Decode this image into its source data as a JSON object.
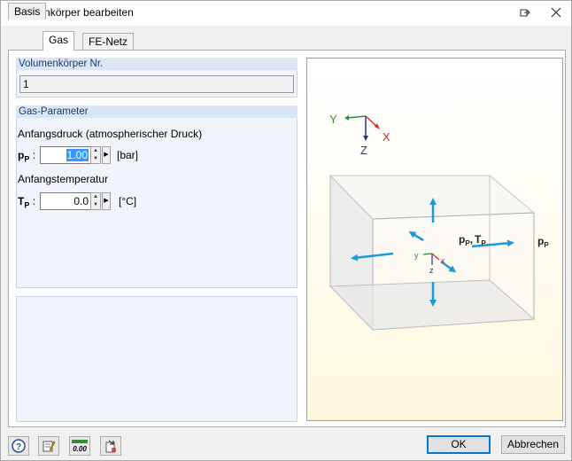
{
  "window": {
    "title": "Volumenkörper bearbeiten"
  },
  "titlebar": {
    "restore_icon": "restore-icon",
    "close_icon": "close-icon"
  },
  "tabs": [
    {
      "label": "Basis",
      "active": false
    },
    {
      "label": "Gas",
      "active": true
    },
    {
      "label": "FE-Netz",
      "active": false
    }
  ],
  "solid_number": {
    "header": "Volumenkörper Nr.",
    "value": "1"
  },
  "gas_parameters": {
    "header": "Gas-Parameter",
    "pressure": {
      "label": "Anfangsdruck (atmospherischer Druck)",
      "symbol": "p",
      "subscript": "P",
      "colon": ":",
      "value": "1.00",
      "unit": "[bar]"
    },
    "temperature": {
      "label": "Anfangstemperatur",
      "symbol": "T",
      "subscript": "P",
      "colon": ":",
      "value": "0.0",
      "unit": "[°C]"
    }
  },
  "diagram": {
    "axes_top": {
      "y": "Y",
      "z": "Z",
      "x": "X"
    },
    "axes_center": {
      "y": "y",
      "z": "z",
      "x": "x"
    },
    "labels": {
      "pp_tp": "p",
      "pp_tp_sub": "P",
      "tp": "T",
      "tp_sub": "P",
      "comma": ",",
      "pp_right": "p",
      "pp_right_sub": "P"
    },
    "colors": {
      "arrow": "#1a9bd7",
      "axis_x": "#e0282d",
      "axis_y": "#2c8c3c",
      "axis_z": "#2b2fa0"
    }
  },
  "footer": {
    "icons": [
      "help-icon",
      "edit-icon",
      "units-icon",
      "document-arrow-icon"
    ],
    "units_icon_text": "0.00",
    "ok_label": "OK",
    "cancel_label": "Abbrechen"
  }
}
